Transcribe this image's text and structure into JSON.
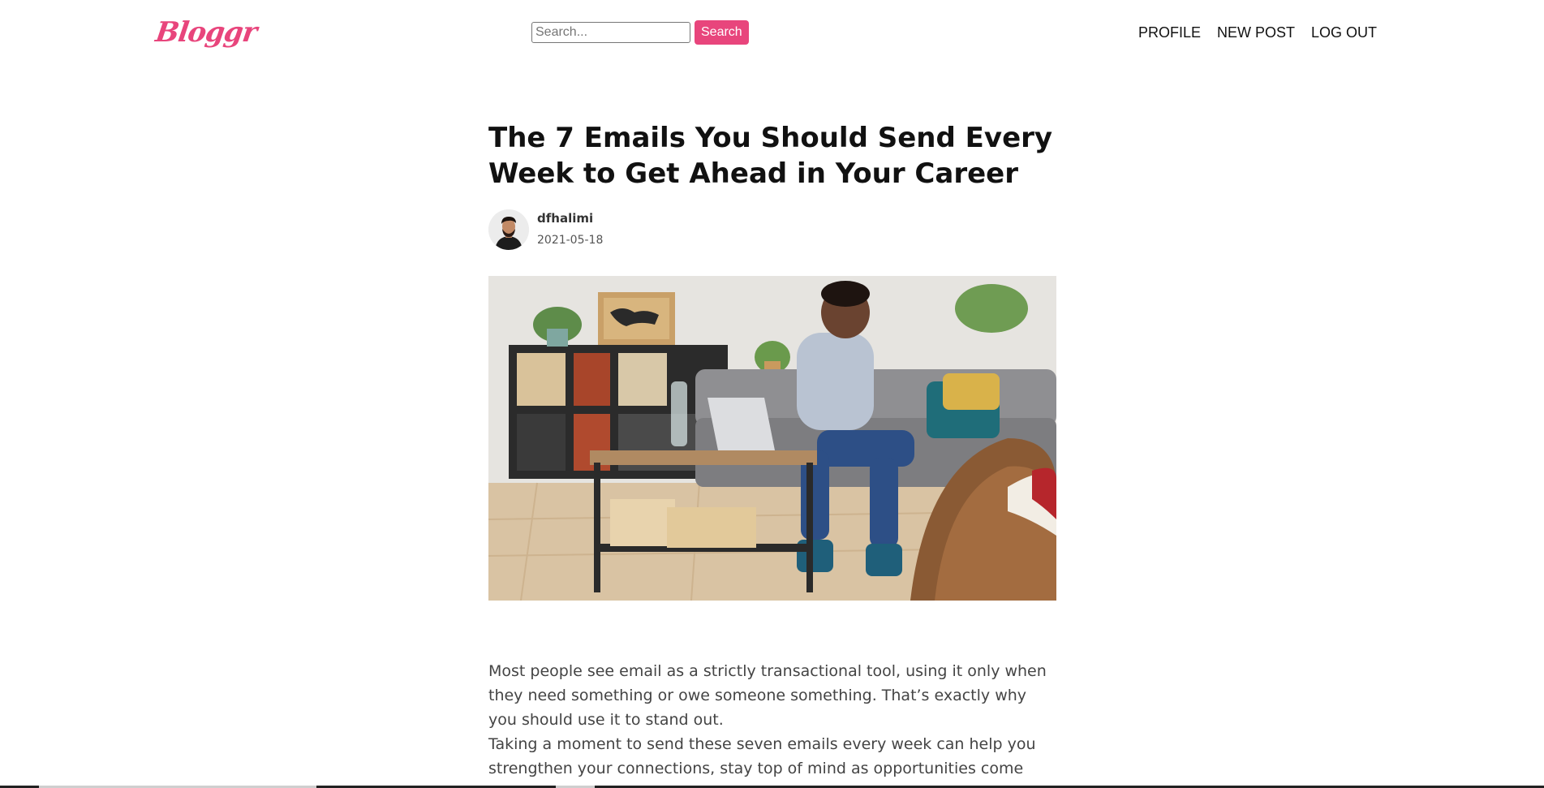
{
  "header": {
    "logo": "Bloggr",
    "search": {
      "placeholder": "Search...",
      "value": "",
      "button_label": "Search"
    },
    "nav": [
      {
        "label": "PROFILE"
      },
      {
        "label": "NEW POST"
      },
      {
        "label": "LOG OUT"
      }
    ]
  },
  "article": {
    "title": "The 7 Emails You Should Send Every Week to Get Ahead in Your Career",
    "author": "dfhalimi",
    "date": "2021-05-18",
    "body": [
      "Most people see email as a strictly transactional tool, using it only when they need something or owe someone something. That’s exactly why you should use it to stand out.",
      "Taking a moment to send these seven emails every week can help you strengthen your connections, stay top of mind as opportunities come"
    ]
  },
  "colors": {
    "accent": "#e8457c"
  },
  "icons": {
    "avatar": "avatar-image",
    "hero": "hero-image"
  }
}
